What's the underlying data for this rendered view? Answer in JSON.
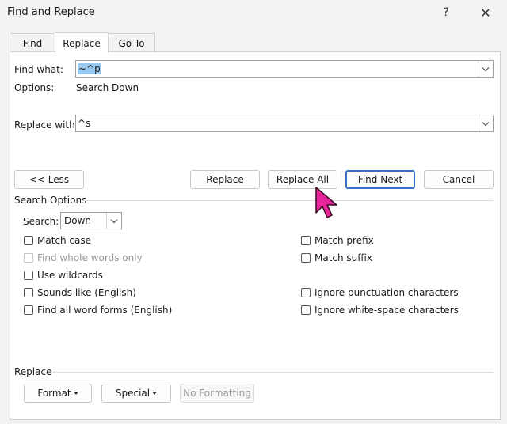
{
  "window": {
    "title": "Find and Replace",
    "help": "?",
    "close": "✕"
  },
  "tabs": [
    {
      "label": "Find"
    },
    {
      "label": "Replace"
    },
    {
      "label": "Go To"
    }
  ],
  "find": {
    "label": "Find what:",
    "value": "~^p",
    "options_label": "Options:",
    "options_value": "Search Down"
  },
  "replace": {
    "label": "Replace with:",
    "value": "^s"
  },
  "buttons": {
    "less": "<< Less",
    "replace": "Replace",
    "replace_all": "Replace All",
    "find_next": "Find Next",
    "cancel": "Cancel"
  },
  "search_options": {
    "heading": "Search Options",
    "search_label": "Search:",
    "search_value": "Down",
    "left": [
      "Match case",
      "Find whole words only",
      "Use wildcards",
      "Sounds like (English)",
      "Find all word forms (English)"
    ],
    "right": [
      "Match prefix",
      "Match suffix",
      "Ignore punctuation characters",
      "Ignore white-space characters"
    ]
  },
  "replace_section": {
    "heading": "Replace",
    "format": "Format",
    "special": "Special",
    "no_formatting": "No Formatting"
  },
  "colors": {
    "accent": "#3a6fd0",
    "cursor": "#e8249a",
    "selection": "#99c9ef"
  }
}
